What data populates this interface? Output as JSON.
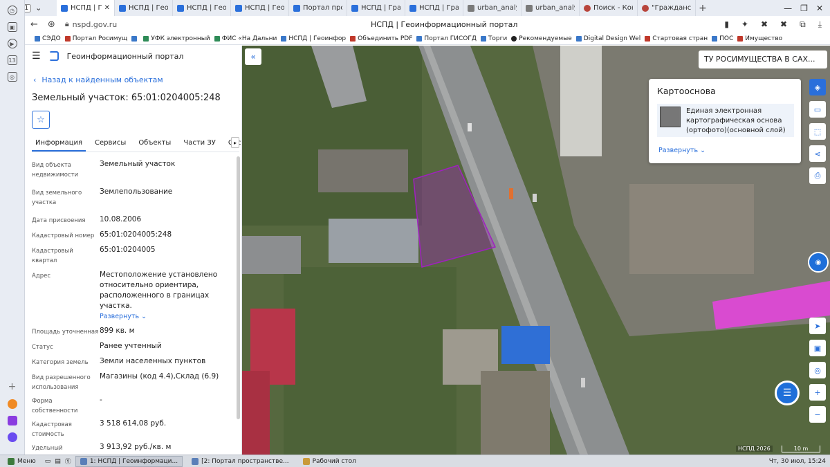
{
  "browser": {
    "tab_count": "11",
    "tabs": [
      {
        "label": "НСПД | Геоин",
        "active": true
      },
      {
        "label": "НСПД | Геоинф"
      },
      {
        "label": "НСПД | Геоинф"
      },
      {
        "label": "НСПД | Геоин"
      },
      {
        "label": "Портал простр"
      },
      {
        "label": "НСПД | Градос"
      },
      {
        "label": "НСПД | Градос"
      },
      {
        "label": "urban_analyze"
      },
      {
        "label": "urban_analyze"
      },
      {
        "label": "Поиск - Консу"
      },
      {
        "label": "\"Гражданский"
      }
    ],
    "url": "nspd.gov.ru",
    "page_title": "НСПД | Геоинформационный портал",
    "sidebar_badge": "13"
  },
  "bookmarks": [
    "СЭДО",
    "Портал Росимущ",
    "",
    "УФК электронный",
    "ФИС «На Дальни",
    "НСПД | Геоинфор",
    "Объединить PDF",
    "Портал ГИСОГД",
    "Торги",
    "Рекомендуемые",
    "Digital Design Wel",
    "Стартовая стран",
    "ПОС",
    "Имущество"
  ],
  "panel": {
    "portal_name": "Геоинформационный портал",
    "back_link": "Назад к найденным объектам",
    "title": "Земельный участок: 65:01:0204005:248",
    "tabs": [
      "Информация",
      "Сервисы",
      "Объекты",
      "Части ЗУ",
      "Состав"
    ],
    "properties": [
      {
        "key": "Вид объекта недвижимости",
        "value": "Земельный участок"
      },
      {
        "key": "Вид земельного участка",
        "value": "Землепользование"
      },
      {
        "key": "Дата присвоения",
        "value": "10.08.2006"
      },
      {
        "key": "Кадастровый номер",
        "value": "65:01:0204005:248"
      },
      {
        "key": "Кадастровый квартал",
        "value": "65:01:0204005"
      },
      {
        "key": "Адрес",
        "value": "Местоположение установлено относительно ориентира, расположенного в границах участка."
      },
      {
        "key": "Площадь уточненная",
        "value": "899 кв. м"
      },
      {
        "key": "Статус",
        "value": "Ранее учтенный"
      },
      {
        "key": "Категория земель",
        "value": "Земли населенных пунктов"
      },
      {
        "key": "Вид разрешенного использования",
        "value": "Магазины (код 4.4),Склад (6.9)"
      },
      {
        "key": "Форма собственности",
        "value": "-"
      },
      {
        "key": "Кадастровая стоимость",
        "value": "3 518 614,08 руб."
      },
      {
        "key": "Удельный показатель",
        "value": "3 913,92 руб./кв. м"
      }
    ],
    "address_expand": "Развернуть"
  },
  "map": {
    "org_select": "ТУ РОСИМУЩЕСТВА В САХ...",
    "basemap_title": "Картооснова",
    "basemap_item": "Единая электронная картографическая основа (ортофото)(основной слой)",
    "basemap_expand": "Развернуть",
    "copyright": "НСПД 2026",
    "scale": "10 m",
    "parcel_color": "#a020c0",
    "roof_magenta": "#d94bd0",
    "roof_blue": "#2f6fd6",
    "roof_red": "#b8364a"
  },
  "taskbar": {
    "menu": "Меню",
    "tasks": [
      "1: НСПД | Геоинформаци...",
      "[2: Портал пространстве...",
      "Рабочий стол"
    ],
    "clock": "Чт, 30 июл, 15:24"
  }
}
